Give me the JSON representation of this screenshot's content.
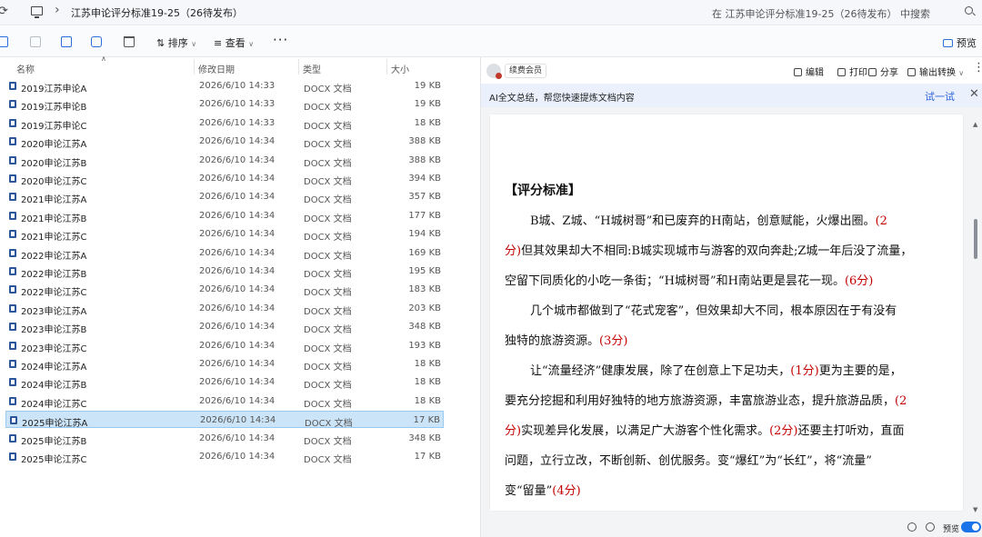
{
  "address_bar": {
    "path": "江苏申论评分标准19-25（26待发布）",
    "search_placeholder": "在 江苏申论评分标准19-25（26待发布） 中搜索"
  },
  "command_bar": {
    "sort_label": "排序",
    "view_label": "查看",
    "more_label": "···",
    "preview_label": "预览"
  },
  "columns": {
    "name": "名称",
    "date": "修改日期",
    "type": "类型",
    "size": "大小"
  },
  "files": [
    {
      "name": "2019江苏申论A",
      "date": "2026/6/10 14:33",
      "type": "DOCX 文档",
      "size": "19 KB"
    },
    {
      "name": "2019江苏申论B",
      "date": "2026/6/10 14:33",
      "type": "DOCX 文档",
      "size": "19 KB"
    },
    {
      "name": "2019江苏申论C",
      "date": "2026/6/10 14:33",
      "type": "DOCX 文档",
      "size": "18 KB"
    },
    {
      "name": "2020申论江苏A",
      "date": "2026/6/10 14:34",
      "type": "DOCX 文档",
      "size": "388 KB"
    },
    {
      "name": "2020申论江苏B",
      "date": "2026/6/10 14:34",
      "type": "DOCX 文档",
      "size": "388 KB"
    },
    {
      "name": "2020申论江苏C",
      "date": "2026/6/10 14:34",
      "type": "DOCX 文档",
      "size": "394 KB"
    },
    {
      "name": "2021申论江苏A",
      "date": "2026/6/10 14:34",
      "type": "DOCX 文档",
      "size": "357 KB"
    },
    {
      "name": "2021申论江苏B",
      "date": "2026/6/10 14:34",
      "type": "DOCX 文档",
      "size": "177 KB"
    },
    {
      "name": "2021申论江苏C",
      "date": "2026/6/10 14:34",
      "type": "DOCX 文档",
      "size": "194 KB"
    },
    {
      "name": "2022申论江苏A",
      "date": "2026/6/10 14:34",
      "type": "DOCX 文档",
      "size": "169 KB"
    },
    {
      "name": "2022申论江苏B",
      "date": "2026/6/10 14:34",
      "type": "DOCX 文档",
      "size": "195 KB"
    },
    {
      "name": "2022申论江苏C",
      "date": "2026/6/10 14:34",
      "type": "DOCX 文档",
      "size": "183 KB"
    },
    {
      "name": "2023申论江苏A",
      "date": "2026/6/10 14:34",
      "type": "DOCX 文档",
      "size": "203 KB"
    },
    {
      "name": "2023申论江苏B",
      "date": "2026/6/10 14:34",
      "type": "DOCX 文档",
      "size": "348 KB"
    },
    {
      "name": "2023申论江苏C",
      "date": "2026/6/10 14:34",
      "type": "DOCX 文档",
      "size": "193 KB"
    },
    {
      "name": "2024申论江苏A",
      "date": "2026/6/10 14:34",
      "type": "DOCX 文档",
      "size": "18 KB"
    },
    {
      "name": "2024申论江苏B",
      "date": "2026/6/10 14:34",
      "type": "DOCX 文档",
      "size": "18 KB"
    },
    {
      "name": "2024申论江苏C",
      "date": "2026/6/10 14:34",
      "type": "DOCX 文档",
      "size": "18 KB"
    },
    {
      "name": "2025申论江苏A",
      "date": "2026/6/10 14:34",
      "type": "DOCX 文档",
      "size": "17 KB",
      "selected": true
    },
    {
      "name": "2025申论江苏B",
      "date": "2026/6/10 14:34",
      "type": "DOCX 文档",
      "size": "348 KB"
    },
    {
      "name": "2025申论江苏C",
      "date": "2026/6/10 14:34",
      "type": "DOCX 文档",
      "size": "17 KB"
    }
  ],
  "preview": {
    "vip_label": "续费会员",
    "edit_label": "编辑",
    "print_label": "打印",
    "share_label": "分享",
    "convert_label": "输出转换",
    "ai_banner_text": "AI全文总结，帮您快速提炼文档内容",
    "ai_try_label": "试一试",
    "status_label": "预览",
    "document": {
      "heading": "【评分标准】",
      "p1_a": "B城、Z城、“H城树哥”和已废弃的H南站，创意赋能，火爆出圈。",
      "p1_score1": "(2",
      "p1_score1b": "分)",
      "p1_b": "但其效果却大不相同:B城实现城市与游客的双向奔赴;Z城一年后没了流量，",
      "p1_c": "空留下同质化的小吃一条街；“H城树哥”和H南站更是昙花一现。",
      "p1_score2": "(6分)",
      "p2_a": "几个城市都做到了“花式宠客”，但效果却大不同，根本原因在于有没有",
      "p2_b": "独特的旅游资源。",
      "p2_score": "(3分)",
      "p3_a": "让“流量经济”健康发展，除了在创意上下足功夫，",
      "p3_score1": "(1分)",
      "p3_b": "更为主要的是，",
      "p3_c": "要充分挖掘和利用好独特的地方旅游资源，丰富旅游业态，提升旅游品质，",
      "p3_score2a": "(2",
      "p3_score2b": "分)",
      "p3_d": "实现差异化发展，以满足广大游客个性化需求。",
      "p3_score3": "(2分)",
      "p3_e": "还要主打听劝，直面",
      "p3_f": "问题，立行立改，不断创新、创优服务。变“爆红”为“长红”，将“流量”",
      "p3_g": "变“留量”",
      "p3_score4": "(4分)"
    }
  }
}
